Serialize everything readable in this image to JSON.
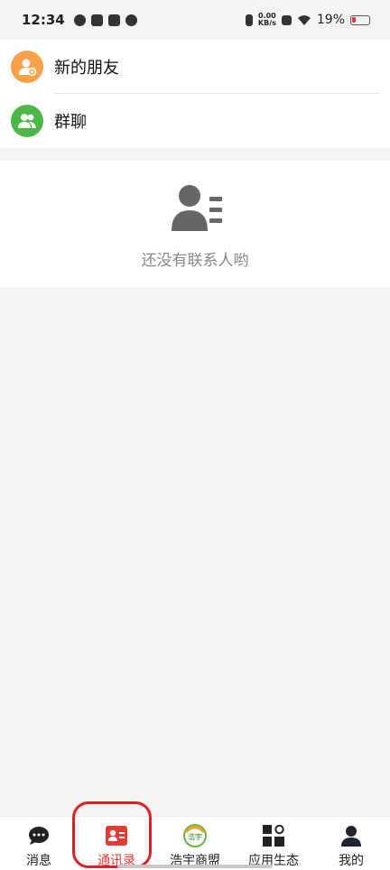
{
  "status_bar": {
    "time": "12:34",
    "network_speed_value": "0.00",
    "network_speed_unit": "KB/s",
    "battery_percent": "19%"
  },
  "contacts": {
    "items": [
      {
        "label": "新的朋友",
        "icon": "new-friend-icon",
        "color": "#f7a14a"
      },
      {
        "label": "群聊",
        "icon": "group-chat-icon",
        "color": "#4cb848"
      }
    ],
    "empty_text": "还没有联系人哟"
  },
  "tabbar": {
    "items": [
      {
        "label": "消息",
        "icon": "chat-bubble-icon"
      },
      {
        "label": "通讯录",
        "icon": "contacts-card-icon",
        "active": true
      },
      {
        "label": "浩宇商盟",
        "icon": "haoyu-logo-icon",
        "logo_text": "浩宇"
      },
      {
        "label": "应用生态",
        "icon": "apps-grid-icon"
      },
      {
        "label": "我的",
        "icon": "person-icon"
      }
    ]
  },
  "colors": {
    "accent_red": "#e23b36",
    "orange": "#f7a14a",
    "green": "#4cb848",
    "background": "#f3f3f3"
  }
}
